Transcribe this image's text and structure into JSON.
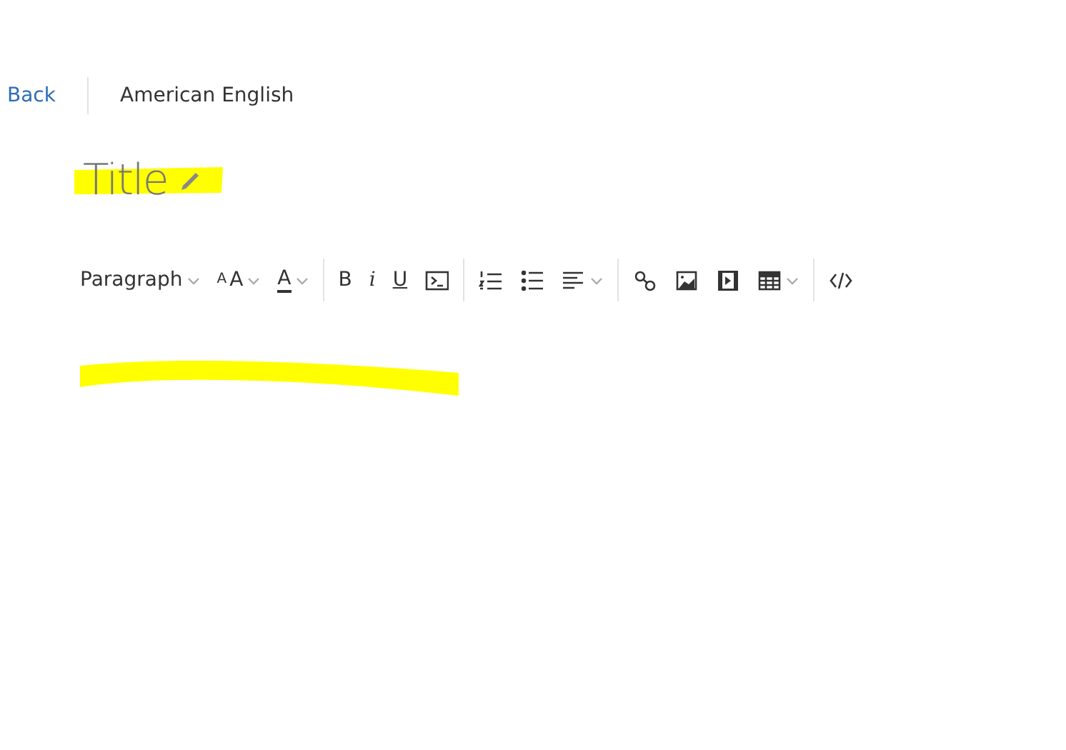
{
  "header": {
    "back": "Back",
    "language": "American English"
  },
  "title": "Title",
  "toolbar": [
    [
      {
        "kind": "format",
        "label": "Paragraph",
        "dropdown": true
      },
      {
        "kind": "size",
        "label": "AA",
        "dropdown": true
      },
      {
        "kind": "color",
        "label": "A",
        "dropdown": true
      }
    ],
    [
      {
        "kind": "bold",
        "label": "B",
        "dropdown": false
      },
      {
        "kind": "italic",
        "label": "i",
        "dropdown": false
      },
      {
        "kind": "underline",
        "label": "U",
        "dropdown": false
      },
      {
        "kind": "code",
        "dropdown": false
      }
    ],
    [
      {
        "kind": "ordered",
        "dropdown": false
      },
      {
        "kind": "bullets",
        "dropdown": false
      },
      {
        "kind": "align",
        "dropdown": true
      }
    ],
    [
      {
        "kind": "link",
        "dropdown": false
      },
      {
        "kind": "image",
        "dropdown": false
      },
      {
        "kind": "video",
        "dropdown": false
      },
      {
        "kind": "table",
        "dropdown": true
      }
    ],
    [
      {
        "kind": "source",
        "dropdown": false
      }
    ]
  ]
}
